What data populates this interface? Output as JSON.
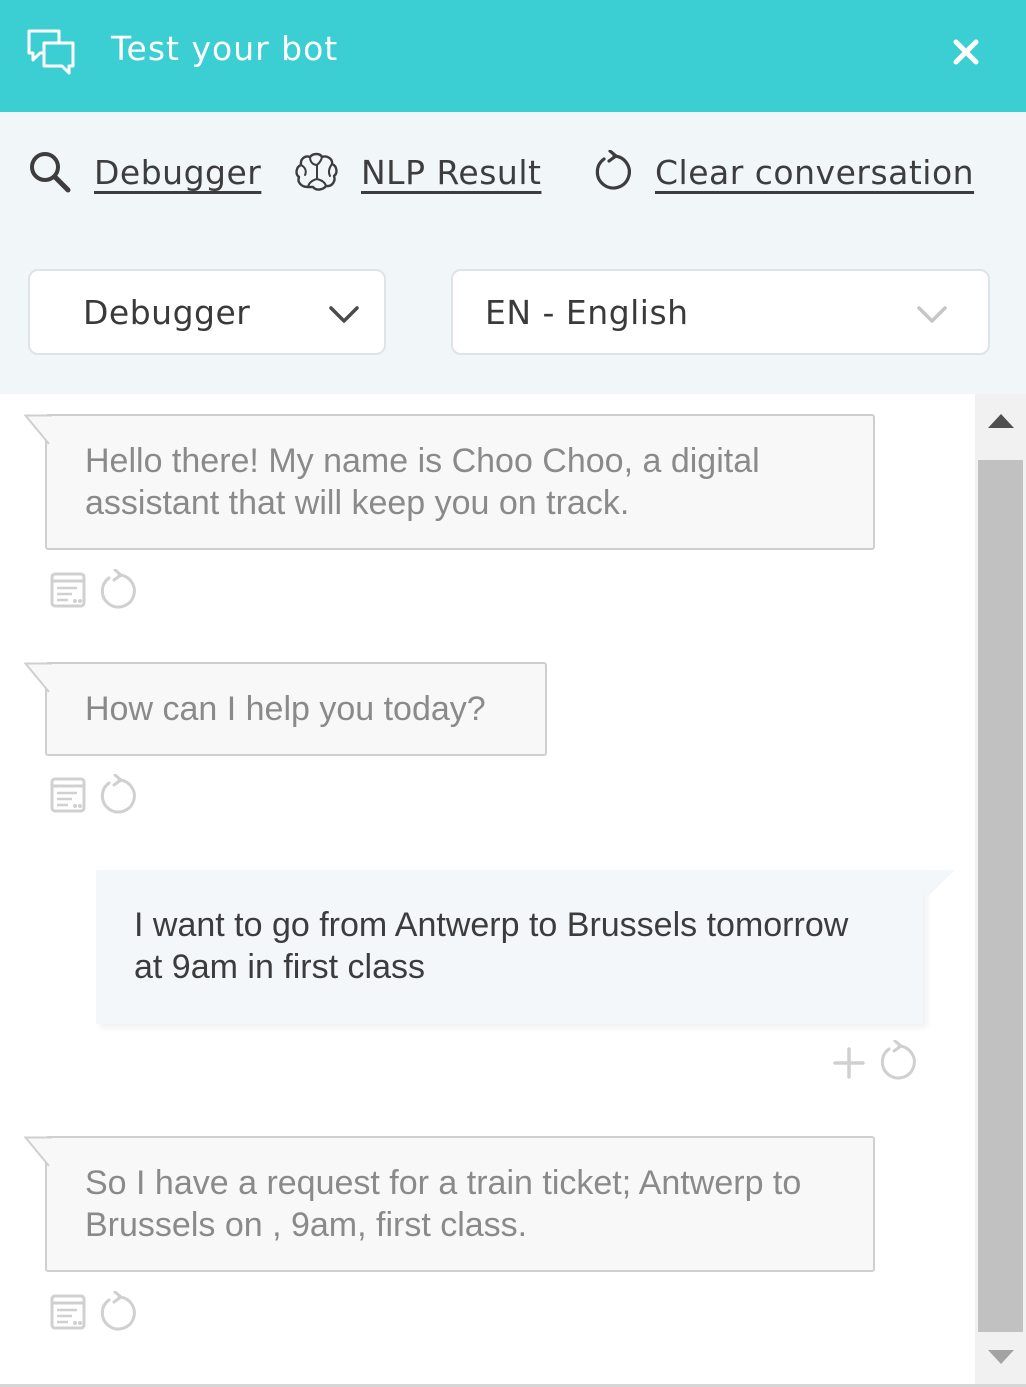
{
  "colors": {
    "accent": "#3bcfd3"
  },
  "header": {
    "title": "Test your bot",
    "chat_icon": "chat-bubbles-icon",
    "close_icon": "close-icon"
  },
  "toolbar": {
    "debugger_label": "Debugger",
    "nlp_label": "NLP Result",
    "clear_label": "Clear conversation",
    "icons": [
      "search-icon",
      "brain-icon",
      "refresh-icon"
    ]
  },
  "selects": {
    "mode": "Debugger",
    "language": "EN - English"
  },
  "messages": [
    {
      "from": "bot",
      "text": "Hello there! My name is Choo Choo, a digital assistant that will keep you on track."
    },
    {
      "from": "bot",
      "text": "How can I help you today?"
    },
    {
      "from": "user",
      "text": "I want to go from Antwerp to Brussels tomorrow at 9am in first class"
    },
    {
      "from": "bot",
      "text": "So I have a request for a train ticket; Antwerp to Brussels on , 9am, first class."
    }
  ]
}
